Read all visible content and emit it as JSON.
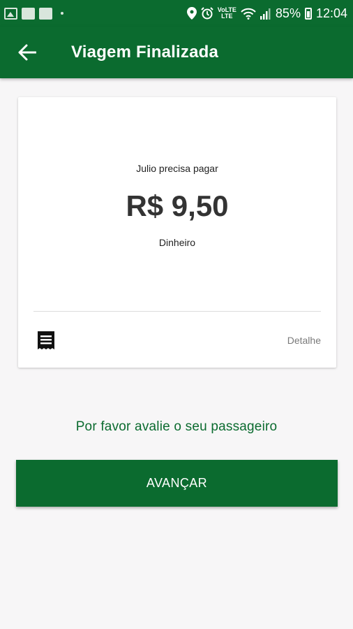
{
  "status_bar": {
    "battery_percent": "85%",
    "time": "12:04",
    "volte_label_top": "VoLTE",
    "volte_label_bottom": "LTE",
    "icons": [
      "image-icon",
      "square-icon",
      "square-icon",
      "dot-icon",
      "location-icon",
      "alarm-icon",
      "volte-icon",
      "wifi-icon",
      "signal-icon",
      "battery-icon"
    ]
  },
  "app_bar": {
    "title": "Viagem Finalizada",
    "back_icon": "arrow-left-icon"
  },
  "payment_card": {
    "label": "Julio precisa pagar",
    "amount": "R$ 9,50",
    "method": "Dinheiro",
    "receipt_icon": "receipt-icon",
    "detail_label": "Detalhe"
  },
  "rating_prompt": "Por favor avalie o seu passageiro",
  "advance_button": "AVANÇAR",
  "colors": {
    "primary": "#0b6b2f",
    "background": "#f7f6f7",
    "card": "#ffffff",
    "amount_text": "#333333",
    "detail_text": "#7a7a7a"
  }
}
